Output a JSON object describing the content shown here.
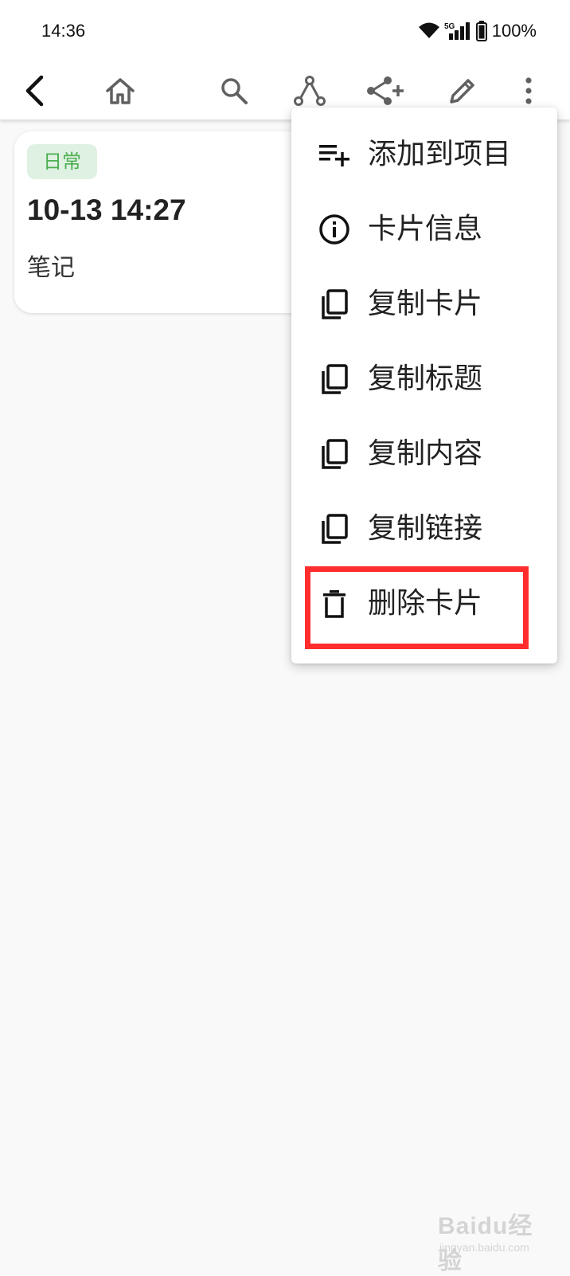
{
  "status_bar": {
    "time": "14:36",
    "network": "5G",
    "battery": "100%"
  },
  "toolbar": {
    "icons": [
      "back-icon",
      "home-icon",
      "search-icon",
      "graph-icon",
      "share-plus-icon",
      "edit-icon",
      "more-vertical-icon"
    ]
  },
  "card": {
    "tag": "日常",
    "title": "10-13 14:27",
    "body": "笔记"
  },
  "menu": {
    "items": [
      {
        "label": "添加到项目",
        "icon": "playlist-add-icon"
      },
      {
        "label": "卡片信息",
        "icon": "info-icon"
      },
      {
        "label": "复制卡片",
        "icon": "copy-icon"
      },
      {
        "label": "复制标题",
        "icon": "copy-icon"
      },
      {
        "label": "复制内容",
        "icon": "copy-icon"
      },
      {
        "label": "复制链接",
        "icon": "copy-icon"
      },
      {
        "label": "删除卡片",
        "icon": "trash-icon"
      }
    ],
    "highlighted_item": "删除卡片"
  },
  "watermark": {
    "logo": "Baidu经验",
    "sub": "jingyan.baidu.com"
  },
  "colors": {
    "tag_bg": "#dff1e2",
    "tag_text": "#4caf50",
    "highlight": "#ff2d2d",
    "toolbar_icon": "#616161"
  }
}
